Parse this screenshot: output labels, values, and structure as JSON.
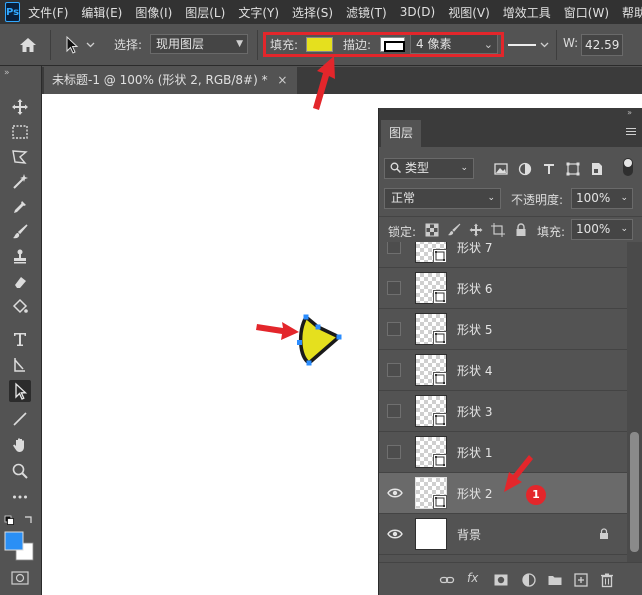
{
  "app": {
    "logo": "Ps",
    "menu": [
      "文件(F)",
      "编辑(E)",
      "图像(I)",
      "图层(L)",
      "文字(Y)",
      "选择(S)",
      "滤镜(T)",
      "3D(D)",
      "视图(V)",
      "增效工具",
      "窗口(W)",
      "帮助(H)"
    ]
  },
  "options": {
    "select_label": "选择:",
    "select_value": "现用图层",
    "fill_label": "填充:",
    "fill_color": "#e5e01e",
    "stroke_label": "描边:",
    "stroke_size": "4 像素",
    "w_label": "W:",
    "w_value": "42.59"
  },
  "document": {
    "tab_title": "未标题-1 @ 100% (形状 2, RGB/8#) *",
    "close": "×"
  },
  "shape": {
    "fill_color": "#e5e01e",
    "stroke_color": "#1a1a1a",
    "anchor_color": "#2a8cff"
  },
  "layers_panel": {
    "tab": "图层",
    "filter_value": "类型",
    "blend_mode": "正常",
    "opacity_label": "不透明度:",
    "opacity_value": "100%",
    "lock_label": "锁定:",
    "fill_label": "填充:",
    "fill_value": "100%",
    "layers": [
      {
        "name": "形状 7",
        "visible": false,
        "selected": false,
        "type": "shape"
      },
      {
        "name": "形状 6",
        "visible": false,
        "selected": false,
        "type": "shape"
      },
      {
        "name": "形状 5",
        "visible": false,
        "selected": false,
        "type": "shape"
      },
      {
        "name": "形状 4",
        "visible": false,
        "selected": false,
        "type": "shape"
      },
      {
        "name": "形状 3",
        "visible": false,
        "selected": false,
        "type": "shape"
      },
      {
        "name": "形状 1",
        "visible": false,
        "selected": false,
        "type": "shape"
      },
      {
        "name": "形状 2",
        "visible": true,
        "selected": true,
        "type": "shape"
      },
      {
        "name": "背景",
        "visible": true,
        "selected": false,
        "type": "background"
      }
    ]
  },
  "annotation": {
    "badge": "1",
    "highlight_color": "#e3262b"
  },
  "icons": {
    "home": "home-icon",
    "move": "move-icon",
    "eye": "eye-icon",
    "lock": "lock-icon"
  }
}
